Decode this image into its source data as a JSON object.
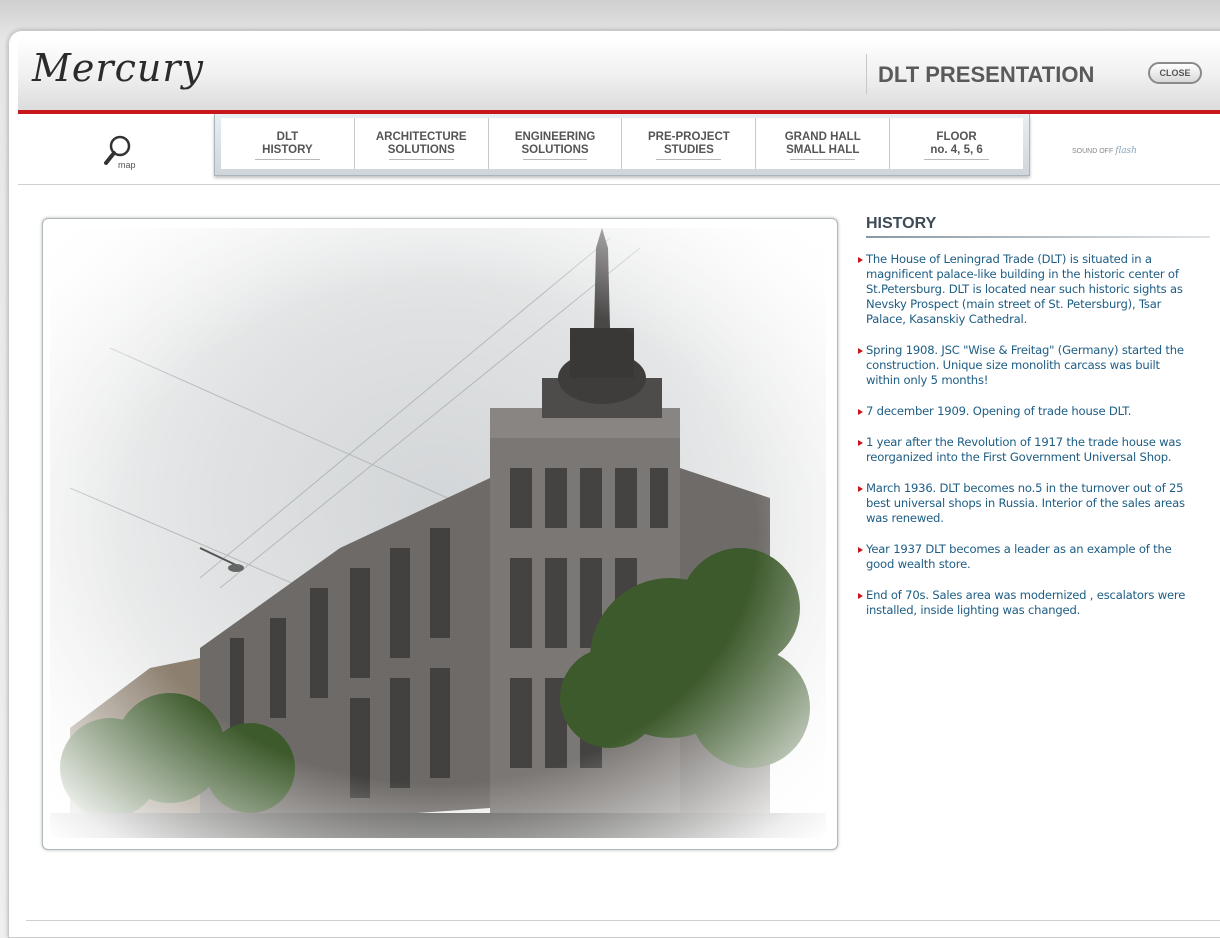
{
  "header": {
    "logo": "Mercury",
    "title": "DLT PRESENTATION",
    "close_label": "CLOSE"
  },
  "nav": {
    "map_label": "map",
    "items": [
      {
        "line1": "DLT",
        "line2": "HISTORY"
      },
      {
        "line1": "ARCHITECTURE",
        "line2": "SOLUTIONS"
      },
      {
        "line1": "ENGINEERING",
        "line2": "SOLUTIONS"
      },
      {
        "line1": "PRE-PROJECT",
        "line2": "STUDIES"
      },
      {
        "line1": "GRAND HALL",
        "line2": "SMALL HALL"
      },
      {
        "line1": "FLOOR",
        "line2": "no. 4, 5, 6"
      }
    ],
    "sound_label": "SOUND OFF",
    "flash_label": "flash"
  },
  "history": {
    "title": "HISTORY",
    "items": [
      "The House of Leningrad Trade (DLT) is situated in a magnificent palace-like building in the historic center of St.Petersburg. DLT is located near such historic sights as Nevsky Prospect (main street of St. Petersburg), Tsar Palace, Kasanskiy Cathedral.",
      "Spring 1908. JSC \"Wise & Freitag\" (Germany) started the construction. Unique size monolith carcass was built within only 5 months!",
      "7 december 1909. Opening of trade house DLT.",
      "1 year after the Revolution of 1917 the trade house was reorganized into the First Government Universal Shop.",
      "March 1936. DLT becomes no.5 in the turnover out of 25  best universal shops in Russia. Interior of the sales areas was renewed.",
      "Year 1937 DLT becomes a leader as an example of the good wealth store.",
      "End of 70s. Sales area was modernized , escalators were  installed, inside lighting was changed."
    ]
  },
  "colors": {
    "accent_red": "#c8161c",
    "history_text": "#1d5d84"
  }
}
